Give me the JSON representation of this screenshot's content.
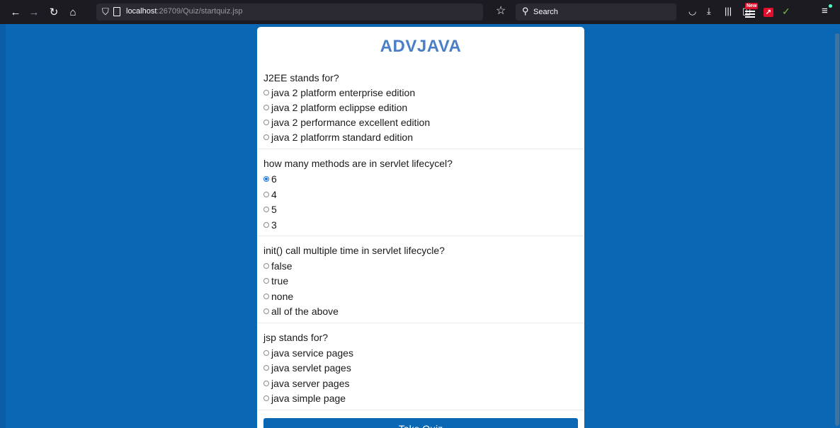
{
  "browser": {
    "url_host": "localhost",
    "url_rest": ":26709/Quiz/startquiz.jsp",
    "search_placeholder": "Search",
    "new_badge": "New"
  },
  "quiz": {
    "title": "ADVJAVA",
    "questions": [
      {
        "text": "J2EE stands for?",
        "options": [
          "java 2 platform enterprise edition",
          "java 2 platform eclippse edition",
          "java 2 performance excellent edition",
          "java 2 platforrm standard edition"
        ]
      },
      {
        "text": "how many methods are in servlet lifecycel?",
        "options": [
          "6",
          "4",
          "5",
          "3"
        ],
        "selected": 0
      },
      {
        "text": "init() call multiple time in servlet lifecycle?",
        "options": [
          "false",
          "true",
          "none",
          "all of the above"
        ]
      },
      {
        "text": "jsp stands for?",
        "options": [
          "java service pages",
          "java servlet pages",
          "java server pages",
          "java simple page"
        ]
      }
    ],
    "submit_label": "Take Quiz"
  }
}
